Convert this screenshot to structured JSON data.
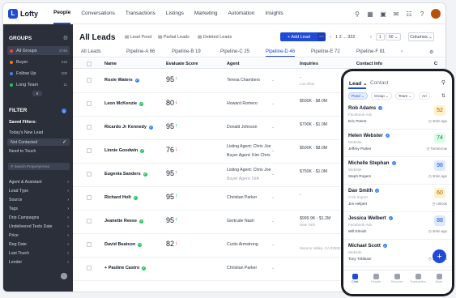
{
  "app": {
    "name": "Lofty"
  },
  "topnav": {
    "tabs": [
      "People",
      "Conversations",
      "Transactions",
      "Listings",
      "Marketing",
      "Automation",
      "Insights"
    ],
    "active": "People"
  },
  "sidebar": {
    "groups_title": "GROUPS",
    "groups": [
      {
        "label": "All Groups",
        "count": "2748",
        "color": "#ef4444"
      },
      {
        "label": "Buyer",
        "count": "318",
        "color": "#f97316"
      },
      {
        "label": "Follow Up",
        "count": "208",
        "color": "#3b82f6"
      },
      {
        "label": "Long Team",
        "count": "11",
        "color": "#22c55e"
      }
    ],
    "filter_title": "FILTER",
    "filter_count": "1",
    "saved_title": "Saved Filters:",
    "saved": [
      "Today's New Lead",
      "Not Contacted",
      "Need to Touch"
    ],
    "search_placeholder": "Search Property/Area",
    "filters": [
      "Agent & Assistant",
      "Lead Type",
      "Source",
      "Tags",
      "Drip Campaigns",
      "Undelivered Texts Date",
      "Price",
      "Reg Date",
      "Last Touch",
      "Lender"
    ]
  },
  "main": {
    "title": "All Leads",
    "tools": [
      "Lead Pond",
      "Partial Leads",
      "Deleted Leads"
    ],
    "add_lead": "+ Add Lead",
    "pager": {
      "pages": "1 2 ... 322",
      "page": "1",
      "per_page": "50"
    },
    "columns_btn": "Columns",
    "tabs": [
      "All Leads",
      "Pipeline-A",
      "Pipeline-B",
      "Pipeline-C",
      "Pipeline-D",
      "Pipeline-E",
      "Pipeline-F"
    ],
    "tab_counts": [
      "",
      "66",
      "19",
      "25",
      "46",
      "72",
      "81"
    ],
    "active_tab": "Pipeline-D",
    "headers": [
      "Name",
      "Evaluate Score",
      "Agent",
      "Inquiries",
      "Contact Info",
      "C"
    ],
    "rows": [
      {
        "name": "Roxie Waters",
        "badge": "#3b82f6",
        "score": "95",
        "dir": "up",
        "agent": "Teresa Chambers",
        "inq": "-",
        "inq2": "Los Altos"
      },
      {
        "name": "Leon McKenzie",
        "badge": "#22c55e",
        "score": "80",
        "dir": "down",
        "agent": "Howard Romero",
        "inq": "$500K - $8.0M",
        "inq2": ""
      },
      {
        "name": "Ricardo Jr Kennedy",
        "badge": "#3b82f6",
        "score": "95",
        "dir": "up",
        "agent": "Donald Johnson",
        "inq": "$700K - $1.0M",
        "inq2": ""
      },
      {
        "name": "Linnie Goodwin",
        "badge": "#22c55e",
        "score": "76",
        "dir": "down",
        "agent": "Listing Agent: Chris Joe",
        "agent_b": "Buyer Agent: Kim Chris",
        "inq": "$500K - $8.0M",
        "inq2": ""
      },
      {
        "name": "Eugenia Sanders",
        "badge": "#22c55e",
        "score": "95",
        "dir": "up",
        "agent": "Listing Agent: Chris Joe",
        "agent_b": "Buyer Agent: N/A",
        "inq": "$750K - $1.0M",
        "inq2": ""
      },
      {
        "name": "Richard Holt",
        "badge": "#22c55e",
        "score": "95",
        "dir": "up",
        "agent": "Christian Parker",
        "inq": "-",
        "inq2": ""
      },
      {
        "name": "Jeanette Reese",
        "badge": "#22c55e",
        "score": "95",
        "dir": "up",
        "agent": "Gertrude Nash",
        "inq": "$999.9K - $1.2M",
        "inq2": "New York"
      },
      {
        "name": "David Beatson",
        "badge": "#22c55e",
        "score": "82",
        "dir": "down",
        "agent": "Curtis Armstrong",
        "inq": "",
        "inq2": "Moreno Valley, CA 92553 USA"
      },
      {
        "name": "+ Pauline Castro",
        "badge": "#22c55e",
        "score": "",
        "dir": "",
        "agent": "Christian Parker",
        "inq": "",
        "inq2": ""
      }
    ]
  },
  "phone": {
    "tabs": [
      "Lead",
      "Contact"
    ],
    "pills": [
      "Pond",
      "Group",
      "Team",
      "Ari"
    ],
    "items": [
      {
        "name": "Rob Adams",
        "badge": "#3b82f6",
        "src": "Facebook Ads",
        "agent": "Eric Peters",
        "score": "52",
        "score_bg": "#fef3c7",
        "score_fg": "#b45309",
        "time": "3min ago"
      },
      {
        "name": "Helen Webster",
        "badge": "#3b82f6",
        "src": "Website",
        "agent": "Jeffrey Parker",
        "score": "74",
        "score_bg": "#dcfce7",
        "score_fg": "#15803d",
        "time": "Tommrrow"
      },
      {
        "name": "Michelle Stephan",
        "badge": "#3b82f6",
        "src": "Website",
        "agent": "Steph Rogers",
        "score": "98",
        "score_bg": "#dbeafe",
        "score_fg": "#1d4ed8",
        "time": "3min ago"
      },
      {
        "name": "Dav Smith",
        "badge": "#3b82f6",
        "src": "CVS Import",
        "agent": "Jim Helpert",
        "score": "60",
        "score_bg": "#fef3c7",
        "score_fg": "#b45309",
        "time": "Unlock"
      },
      {
        "name": "Jessica Welbert",
        "badge": "#3b82f6",
        "src": "Facebook Ads",
        "agent": "Will Elmish",
        "score": "88",
        "score_bg": "#dbeafe",
        "score_fg": "#1d4ed8",
        "time": "3min ago"
      },
      {
        "name": "Michael Scott",
        "badge": "#3b82f6",
        "src": "Website",
        "agent": "Tony Tribbiani",
        "score": "",
        "score_bg": "#ffffff",
        "score_fg": "#ffffff",
        "time": "3min ago"
      }
    ],
    "bottom_nav": [
      "Chat",
      "People",
      "Discover",
      "Transaction",
      "More"
    ]
  },
  "colors": {
    "accent": "#1f4bd6",
    "sidebar": "#2b2f3a"
  }
}
